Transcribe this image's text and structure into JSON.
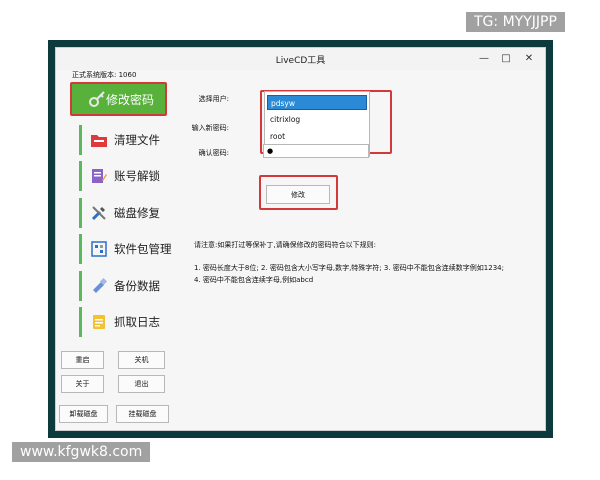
{
  "window": {
    "title": "LiveCD工具",
    "version": "正式系统版本:  1060",
    "minimize": "—",
    "maximize": "□",
    "close": "✕"
  },
  "sidebar": {
    "items": [
      {
        "label": "修改密码",
        "icon": "key-icon",
        "active": true
      },
      {
        "label": "清理文件",
        "icon": "folder-icon"
      },
      {
        "label": "账号解锁",
        "icon": "edit-icon"
      },
      {
        "label": "磁盘修复",
        "icon": "wrench-icon"
      },
      {
        "label": "软件包管理",
        "icon": "package-icon"
      },
      {
        "label": "备份数据",
        "icon": "usb-icon"
      },
      {
        "label": "抓取日志",
        "icon": "log-icon"
      }
    ],
    "buttons": {
      "restart": "重启",
      "shutdown": "关机",
      "about": "关于",
      "exit": "退出",
      "unmount": "卸载磁盘",
      "mount": "挂载磁盘"
    }
  },
  "form": {
    "user_label": "选择用户:",
    "new_pw_label": "输入新密码:",
    "confirm_label": "确认密码:",
    "users": [
      "pdsyw",
      "citrixlog",
      "root"
    ],
    "confirm_mask": "●",
    "submit": "修改"
  },
  "notes": {
    "line1": "请注意:如果打过等保补丁,请确保修改的密码符合以下规则:",
    "line2": "1. 密码长度大于8位;  2. 密码包含大小写字母,数字,特殊字符; 3. 密码中不能包含连续数字例如1234;",
    "line3": "4. 密码中不能包含连续字母,例如abcd"
  },
  "watermarks": {
    "top": "TG: MYYJJPP",
    "bottom": "www.kfgwk8.com"
  }
}
